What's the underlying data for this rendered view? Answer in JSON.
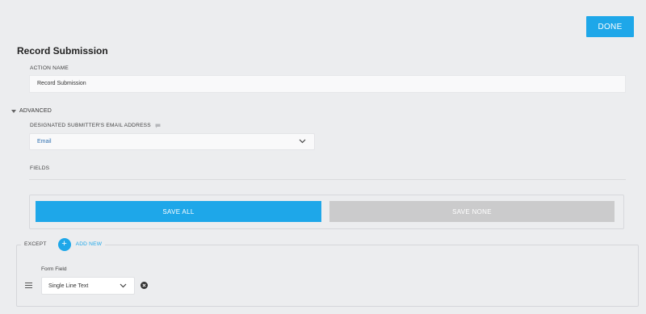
{
  "header": {
    "done_label": "DONE",
    "title": "Record Submission"
  },
  "action_name": {
    "label": "ACTION NAME",
    "value": "Record Submission"
  },
  "advanced": {
    "label": "ADVANCED"
  },
  "email": {
    "label": "DESIGNATED SUBMITTER'S EMAIL ADDRESS",
    "selected": "Email"
  },
  "fields": {
    "label": "FIELDS",
    "save_all_label": "SAVE ALL",
    "save_none_label": "SAVE NONE"
  },
  "except": {
    "label": "EXCEPT",
    "add_icon": "+",
    "add_new_label": "ADD NEW",
    "rows": [
      {
        "field_label": "Form Field",
        "selected": "Single Line Text"
      }
    ]
  },
  "colors": {
    "accent": "#1ea7e9",
    "disabled": "#cbcbcc",
    "background": "#ecedef"
  }
}
